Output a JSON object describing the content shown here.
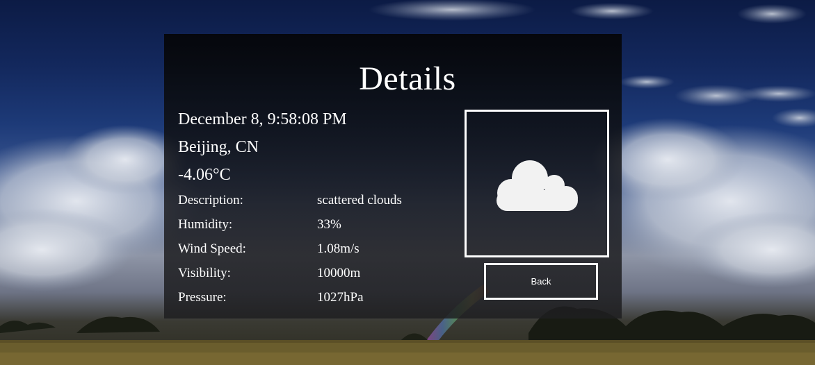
{
  "page": {
    "title": "Details"
  },
  "weather": {
    "datetime": "December 8, 9:58:08 PM",
    "location": "Beijing, CN",
    "temperature": "-4.06°C",
    "details": [
      {
        "label": "Description:",
        "value": "scattered clouds"
      },
      {
        "label": "Humidity:",
        "value": "33%"
      },
      {
        "label": "Wind Speed:",
        "value": "1.08m/s"
      },
      {
        "label": "Visibility:",
        "value": "10000m"
      },
      {
        "label": "Pressure:",
        "value": "1027hPa"
      }
    ],
    "icon": "cloud-icon"
  },
  "actions": {
    "back_label": "Back"
  },
  "colors": {
    "text": "#ffffff",
    "border": "#ffffff",
    "icon_fill": "#f2f2f2"
  }
}
